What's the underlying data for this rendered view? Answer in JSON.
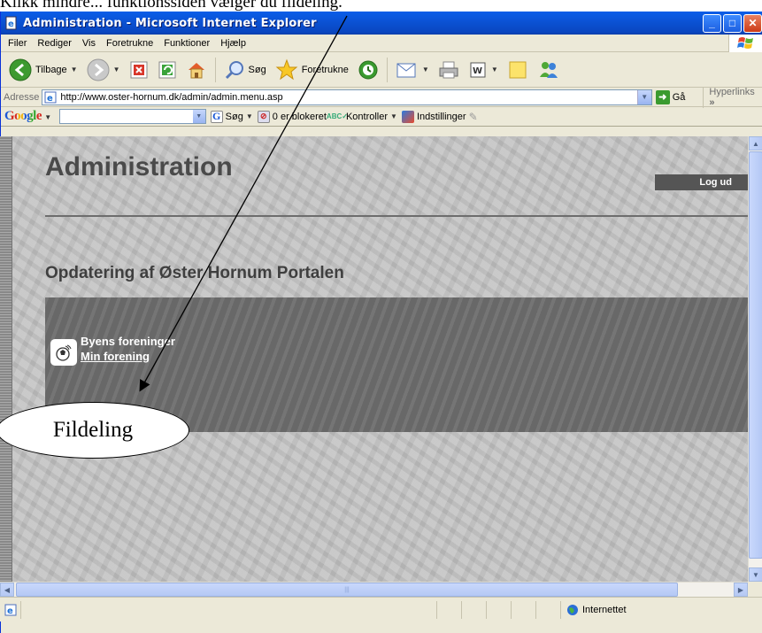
{
  "document_caption": "Klikk mindre... funktionssiden vælger du fildeling.",
  "window": {
    "title": "Administration - Microsoft Internet Explorer",
    "controls": {
      "minimize": "_",
      "maximize": "□",
      "close": "✕"
    }
  },
  "menu": {
    "items": [
      {
        "label": "Filer"
      },
      {
        "label": "Rediger"
      },
      {
        "label": "Vis"
      },
      {
        "label": "Foretrukne"
      },
      {
        "label": "Funktioner"
      },
      {
        "label": "Hjælp"
      }
    ]
  },
  "toolbar": {
    "back_label": "Tilbage",
    "search_label": "Søg",
    "favorites_label": "Foretrukne"
  },
  "address": {
    "label": "Adresse",
    "url": "http://www.oster-hornum.dk/admin/admin.menu.asp",
    "go_label": "Gå",
    "hyperlinks_label": "Hyperlinks",
    "more": "»"
  },
  "googlebar": {
    "logo": "Google",
    "search_label": "Søg",
    "blocked_label": "0 er blokeret",
    "spellcheck_label": "Kontroller",
    "settings_label": "Indstillinger"
  },
  "page": {
    "title": "Administration",
    "logout_label": "Log ud",
    "section_title": "Opdatering af Øster Hornum Portalen",
    "association_heading": "Byens foreninger",
    "association_link": "Min forening"
  },
  "annotation": {
    "callout_text": "Fildeling"
  },
  "statusbar": {
    "zone_label": "Internettet"
  },
  "colors": {
    "xp_titlebar": "#0b53d6",
    "content_bg": "#c3c3c3",
    "panel_bg": "#6e6e6e",
    "logout_bg": "#555555"
  }
}
